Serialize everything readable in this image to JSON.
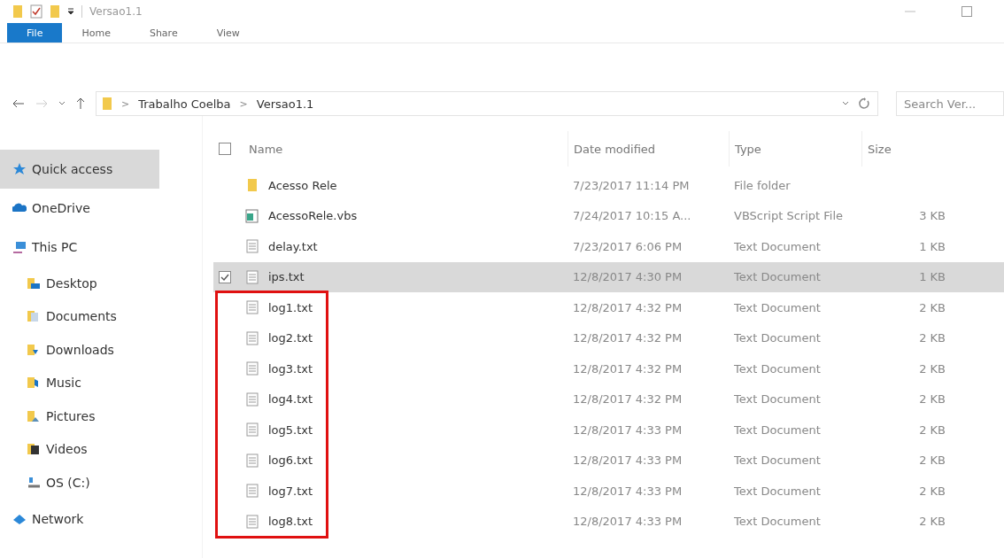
{
  "window": {
    "title": "Versao1.1"
  },
  "ribbon_tabs": [
    {
      "label": "File",
      "selected": true
    },
    {
      "label": "Home",
      "selected": false
    },
    {
      "label": "Share",
      "selected": false
    },
    {
      "label": "View",
      "selected": false
    }
  ],
  "address": {
    "separator": ">",
    "path": [
      "Trabalho Coelba",
      "Versao1.1"
    ]
  },
  "search": {
    "placeholder": "Search Ver..."
  },
  "sidebar": {
    "items": [
      {
        "label": "Quick access",
        "kind": "quick",
        "selected": true
      },
      {
        "label": "OneDrive",
        "kind": "cloud",
        "selected": false
      },
      {
        "label": "This PC",
        "kind": "pc",
        "selected": false,
        "children": [
          {
            "label": "Desktop",
            "kind": "desktop",
            "selected": false
          },
          {
            "label": "Documents",
            "kind": "documents",
            "selected": false
          },
          {
            "label": "Downloads",
            "kind": "downloads",
            "selected": false
          },
          {
            "label": "Music",
            "kind": "music",
            "selected": false
          },
          {
            "label": "Pictures",
            "kind": "pictures",
            "selected": false
          },
          {
            "label": "Videos",
            "kind": "videos",
            "selected": false
          },
          {
            "label": "OS (C:)",
            "kind": "drive",
            "selected": false
          }
        ]
      },
      {
        "label": "Network",
        "kind": "network",
        "selected": false
      }
    ]
  },
  "table": {
    "columns": [
      "Name",
      "Date modified",
      "Type",
      "Size"
    ],
    "header_checkbox": {
      "checked": false
    },
    "rows": [
      {
        "name": "Acesso Rele",
        "date": "7/23/2017 11:14 PM",
        "type": "File folder",
        "kind": "folder",
        "selected": false,
        "highlighted": false
      },
      {
        "name": "AcessoRele.vbs",
        "date": "7/24/2017 10:15 A...",
        "type": "VBScript Script File",
        "size": "3 KB",
        "kind": "script",
        "selected": false,
        "highlighted": false
      },
      {
        "name": "delay.txt",
        "date": "7/23/2017 6:06 PM",
        "type": "Text Document",
        "size": "1 KB",
        "kind": "text",
        "selected": false,
        "highlighted": false
      },
      {
        "name": "ips.txt",
        "date": "12/8/2017 4:30 PM",
        "type": "Text Document",
        "size": "1 KB",
        "kind": "text",
        "selected": true,
        "highlighted": false
      },
      {
        "name": "log1.txt",
        "date": "12/8/2017 4:32 PM",
        "type": "Text Document",
        "size": "2 KB",
        "kind": "text",
        "selected": false,
        "highlighted": true
      },
      {
        "name": "log2.txt",
        "date": "12/8/2017 4:32 PM",
        "type": "Text Document",
        "size": "2 KB",
        "kind": "text",
        "selected": false,
        "highlighted": true
      },
      {
        "name": "log3.txt",
        "date": "12/8/2017 4:32 PM",
        "type": "Text Document",
        "size": "2 KB",
        "kind": "text",
        "selected": false,
        "highlighted": true
      },
      {
        "name": "log4.txt",
        "date": "12/8/2017 4:32 PM",
        "type": "Text Document",
        "size": "2 KB",
        "kind": "text",
        "selected": false,
        "highlighted": true
      },
      {
        "name": "log5.txt",
        "date": "12/8/2017 4:33 PM",
        "type": "Text Document",
        "size": "2 KB",
        "kind": "text",
        "selected": false,
        "highlighted": true
      },
      {
        "name": "log6.txt",
        "date": "12/8/2017 4:33 PM",
        "type": "Text Document",
        "size": "2 KB",
        "kind": "text",
        "selected": false,
        "highlighted": true
      },
      {
        "name": "log7.txt",
        "date": "12/8/2017 4:33 PM",
        "type": "Text Document",
        "size": "2 KB",
        "kind": "text",
        "selected": false,
        "highlighted": true
      },
      {
        "name": "log8.txt",
        "date": "12/8/2017 4:33 PM",
        "type": "Text Document",
        "size": "2 KB",
        "kind": "text",
        "selected": false,
        "highlighted": true
      }
    ]
  }
}
